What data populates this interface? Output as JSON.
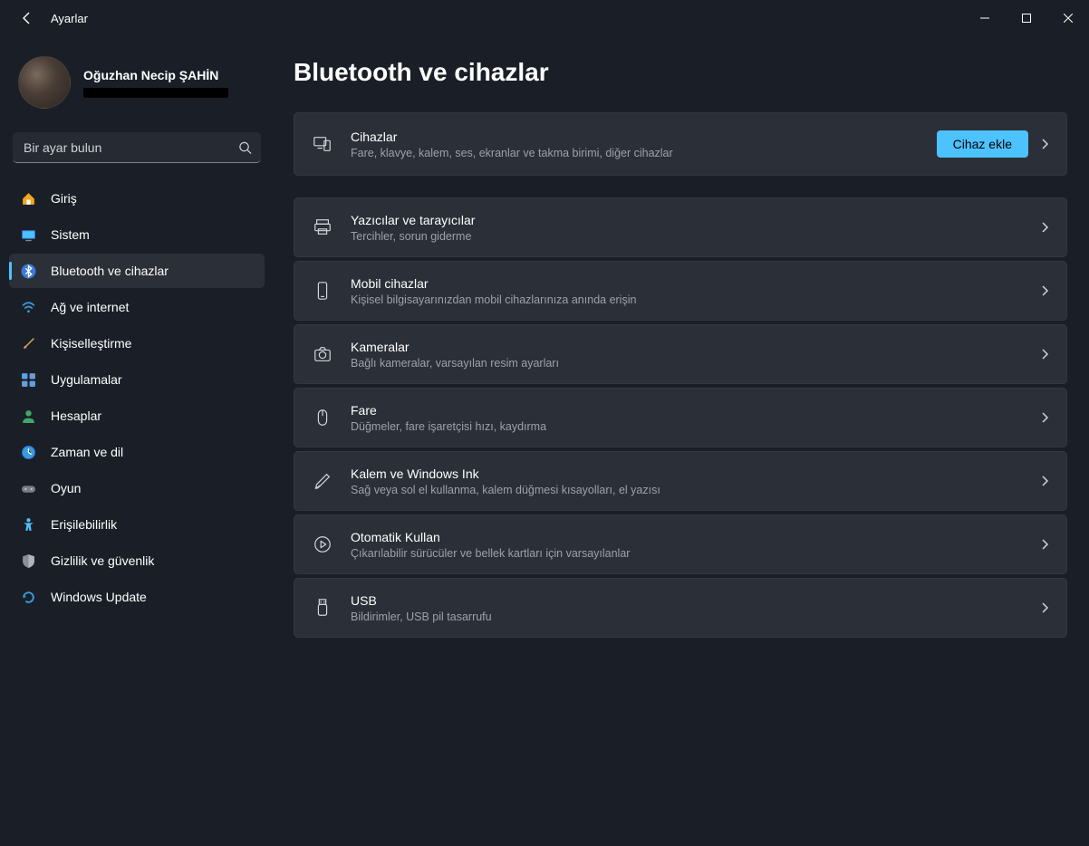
{
  "window": {
    "app_title": "Ayarlar"
  },
  "profile": {
    "name": "Oğuzhan Necip ŞAHİN"
  },
  "search": {
    "placeholder": "Bir ayar bulun"
  },
  "colors": {
    "accent": "#4cc2ff",
    "bg": "#1a1f27",
    "card": "#2b2f37"
  },
  "sidebar": {
    "items": [
      {
        "label": "Giriş",
        "icon": "home-icon",
        "active": false
      },
      {
        "label": "Sistem",
        "icon": "system-icon",
        "active": false
      },
      {
        "label": "Bluetooth ve cihazlar",
        "icon": "bluetooth-icon",
        "active": true
      },
      {
        "label": "Ağ ve internet",
        "icon": "wifi-icon",
        "active": false
      },
      {
        "label": "Kişiselleştirme",
        "icon": "brush-icon",
        "active": false
      },
      {
        "label": "Uygulamalar",
        "icon": "apps-icon",
        "active": false
      },
      {
        "label": "Hesaplar",
        "icon": "person-icon",
        "active": false
      },
      {
        "label": "Zaman ve dil",
        "icon": "clock-icon",
        "active": false
      },
      {
        "label": "Oyun",
        "icon": "gamepad-icon",
        "active": false
      },
      {
        "label": "Erişilebilirlik",
        "icon": "accessibility-icon",
        "active": false
      },
      {
        "label": "Gizlilik ve güvenlik",
        "icon": "shield-icon",
        "active": false
      },
      {
        "label": "Windows Update",
        "icon": "update-icon",
        "active": false
      }
    ]
  },
  "page": {
    "title": "Bluetooth ve cihazlar",
    "add_device_label": "Cihaz ekle",
    "cards": [
      {
        "title": "Cihazlar",
        "sub": "Fare, klavye, kalem, ses, ekranlar ve takma birimi, diğer cihazlar",
        "icon": "devices-icon"
      },
      {
        "title": "Yazıcılar ve tarayıcılar",
        "sub": "Tercihler, sorun giderme",
        "icon": "printer-icon"
      },
      {
        "title": "Mobil cihazlar",
        "sub": "Kişisel bilgisayarınızdan mobil cihazlarınıza anında erişin",
        "icon": "phone-icon"
      },
      {
        "title": "Kameralar",
        "sub": "Bağlı kameralar, varsayılan resim ayarları",
        "icon": "camera-icon"
      },
      {
        "title": "Fare",
        "sub": "Düğmeler, fare işaretçisi hızı, kaydırma",
        "icon": "mouse-icon"
      },
      {
        "title": "Kalem ve Windows Ink",
        "sub": "Sağ veya sol el kullanma, kalem düğmesi kısayolları, el yazısı",
        "icon": "pen-icon"
      },
      {
        "title": "Otomatik Kullan",
        "sub": "Çıkarılabilir sürücüler ve bellek kartları için varsayılanlar",
        "icon": "autoplay-icon"
      },
      {
        "title": "USB",
        "sub": "Bildirimler, USB pil tasarrufu",
        "icon": "usb-icon"
      }
    ]
  }
}
